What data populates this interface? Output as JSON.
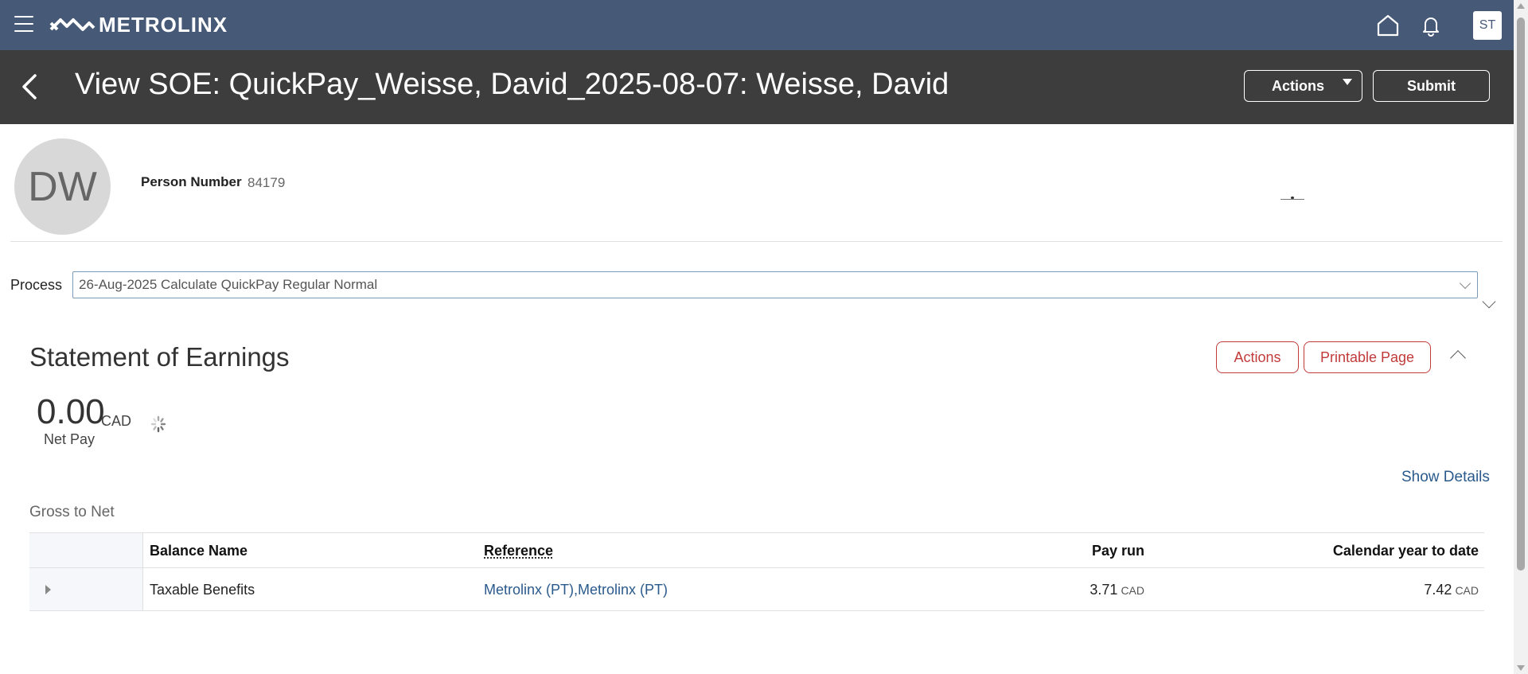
{
  "header": {
    "logo_text": "METROLINX",
    "user_initials": "ST"
  },
  "titlebar": {
    "title": "View SOE: QuickPay_Weisse, David_2025-08-07: Weisse, David",
    "actions_label": "Actions",
    "submit_label": "Submit"
  },
  "person": {
    "initials": "DW",
    "number_label": "Person Number",
    "number_value": "84179"
  },
  "process": {
    "label": "Process",
    "selected": "26-Aug-2025 Calculate QuickPay Regular Normal"
  },
  "soe": {
    "title": "Statement of Earnings",
    "actions_label": "Actions",
    "printable_label": "Printable Page",
    "net_amount": "0.00",
    "net_currency": "CAD",
    "net_label": "Net Pay",
    "show_details": "Show Details",
    "section_label": "Gross to Net"
  },
  "table": {
    "columns": [
      "Balance Name",
      "Reference",
      "Pay run",
      "Calendar year to date"
    ],
    "rows": [
      {
        "balance_name": "Taxable Benefits",
        "reference": "Metrolinx (PT),Metrolinx (PT)",
        "pay_run": "3.71",
        "pay_run_currency": "CAD",
        "ytd": "7.42",
        "ytd_currency": "CAD"
      }
    ]
  }
}
